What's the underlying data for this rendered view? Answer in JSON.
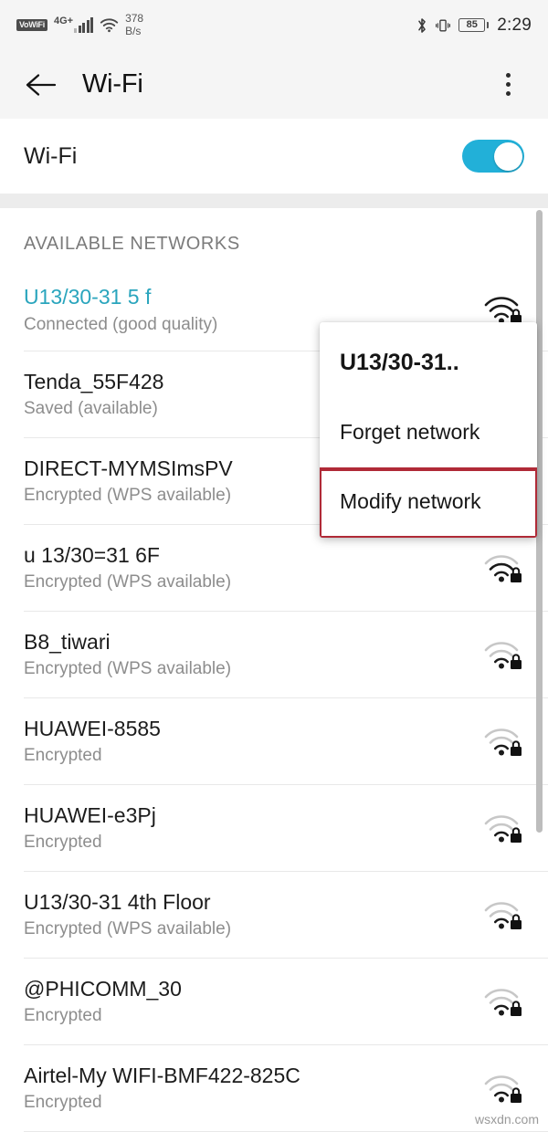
{
  "statusbar": {
    "vowifi_label": "VoWiFi",
    "network_type": "4G+",
    "data_rate_value": "378",
    "data_rate_unit": "B/s",
    "battery_level": "85",
    "time": "2:29",
    "icons": {
      "signal": "cellular-signal-icon",
      "wifi": "wifi-icon",
      "bluetooth": "bluetooth-icon",
      "vibrate": "vibrate-icon",
      "battery": "battery-icon"
    }
  },
  "appbar": {
    "back_icon": "back-arrow-icon",
    "title": "Wi-Fi",
    "overflow_icon": "overflow-menu-icon"
  },
  "wifi_toggle": {
    "label": "Wi-Fi",
    "state": "on",
    "accent_color": "#22b0d8"
  },
  "list": {
    "section_header": "AVAILABLE NETWORKS",
    "networks": [
      {
        "name": "U13/30-31 5 f",
        "status": "Connected (good quality)",
        "connected": true,
        "secure": true,
        "signal": 3
      },
      {
        "name": "Tenda_55F428",
        "status": "Saved (available)",
        "connected": false,
        "secure": true,
        "signal": 3
      },
      {
        "name": "DIRECT-MYMSImsPV",
        "status": "Encrypted (WPS available)",
        "connected": false,
        "secure": true,
        "signal": 3
      },
      {
        "name": "u 13/30=31 6F",
        "status": "Encrypted (WPS available)",
        "connected": false,
        "secure": true,
        "signal": 2
      },
      {
        "name": "B8_tiwari",
        "status": "Encrypted (WPS available)",
        "connected": false,
        "secure": true,
        "signal": 1
      },
      {
        "name": "HUAWEI-8585",
        "status": "Encrypted",
        "connected": false,
        "secure": true,
        "signal": 1
      },
      {
        "name": "HUAWEI-e3Pj",
        "status": "Encrypted",
        "connected": false,
        "secure": true,
        "signal": 1
      },
      {
        "name": "U13/30-31 4th Floor",
        "status": "Encrypted (WPS available)",
        "connected": false,
        "secure": true,
        "signal": 1
      },
      {
        "name": "@PHICOMM_30",
        "status": "Encrypted",
        "connected": false,
        "secure": true,
        "signal": 1
      },
      {
        "name": "Airtel-My WIFI-BMF422-825C",
        "status": "Encrypted",
        "connected": false,
        "secure": true,
        "signal": 1
      }
    ]
  },
  "popup": {
    "title": "U13/30-31..",
    "items": [
      {
        "label": "Forget network",
        "highlighted": false
      },
      {
        "label": "Modify network",
        "highlighted": true
      }
    ],
    "highlight_color": "#b02a37"
  },
  "watermark": "wsxdn.com"
}
